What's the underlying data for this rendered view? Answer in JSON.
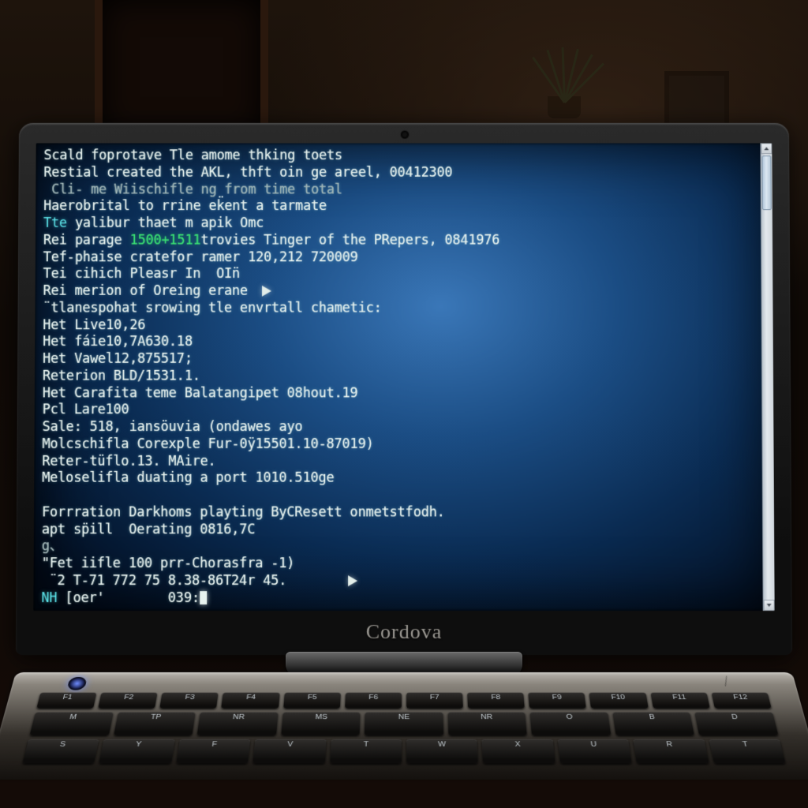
{
  "laptop": {
    "brand": "Cordova"
  },
  "terminal": {
    "lines": [
      {
        "segs": [
          {
            "t": "Scald foprotave Tle amome thking toets"
          }
        ]
      },
      {
        "segs": [
          {
            "t": "Restial created the AKL, thft oin ge areel, 00412300"
          }
        ]
      },
      {
        "segs": [
          {
            "t": " Cli- me Wiischifle ng from time total",
            "cls": "dim"
          }
        ]
      },
      {
        "segs": [
          {
            "t": "Haerobrital to rrine ek̈ent a tarmate"
          }
        ]
      },
      {
        "segs": [
          {
            "t": "Tte ",
            "cls": "c"
          },
          {
            "t": "yalibur thaet m apik Omc"
          }
        ]
      },
      {
        "segs": [
          {
            "t": "Rei parage "
          },
          {
            "t": "1500+1511",
            "cls": "g"
          },
          {
            "t": "trovies Tinger of the PRepers, 0841976"
          }
        ]
      },
      {
        "segs": [
          {
            "t": "Tef-phaise cratefor ramer 120,212 720009"
          }
        ]
      },
      {
        "segs": [
          {
            "t": "Tei cihich Pleasr In  OIn̈"
          }
        ]
      },
      {
        "segs": [
          {
            "t": "Rei merion of Oreing erane "
          }
        ],
        "play": true
      },
      {
        "segs": [
          {
            "t": "¨tlanespohat srowing tle envrtall chametic:"
          }
        ]
      },
      {
        "segs": [
          {
            "t": "Het Live10,26"
          }
        ]
      },
      {
        "segs": [
          {
            "t": "Het fáie10,7A630.18"
          }
        ]
      },
      {
        "segs": [
          {
            "t": "Het Vawel12,875517;"
          }
        ]
      },
      {
        "segs": [
          {
            "t": "Reterion BLD/1531.1."
          }
        ]
      },
      {
        "segs": [
          {
            "t": "Het Carafita teme Balatangipet 08hout.19"
          }
        ]
      },
      {
        "segs": [
          {
            "t": "Pcl Lare100"
          }
        ]
      },
      {
        "segs": [
          {
            "t": "Sale: 518, iansöuvia (ondawes ayo"
          }
        ]
      },
      {
        "segs": [
          {
            "t": "Molcschifla Corexple Fur-0ÿ15501.10-87019)"
          }
        ]
      },
      {
        "segs": [
          {
            "t": "Reter-tüflo.13. MAire."
          }
        ]
      },
      {
        "segs": [
          {
            "t": "Meloselifla duating a port 1010.510ge"
          }
        ]
      },
      {
        "segs": []
      },
      {
        "segs": [
          {
            "t": "Forrration Darkhoms playting ByCResett onmetstfodh."
          }
        ]
      },
      {
        "segs": [
          {
            "t": "apt sp̈ill  Oerating 0816,7C"
          }
        ]
      },
      {
        "segs": [
          {
            "t": "g、",
            "cls": "dim"
          }
        ]
      },
      {
        "segs": [
          {
            "t": "\"Fet iifle 100 prr-Chorasfra -1)"
          }
        ]
      },
      {
        "segs": [
          {
            "t": " ¨2 T-71 772 75 8.38-86T24r 45.       "
          }
        ],
        "play": true
      },
      {
        "segs": [
          {
            "t": "NH ",
            "cls": "c"
          },
          {
            "t": "[oer'        039:"
          }
        ],
        "cursor": true
      }
    ]
  }
}
